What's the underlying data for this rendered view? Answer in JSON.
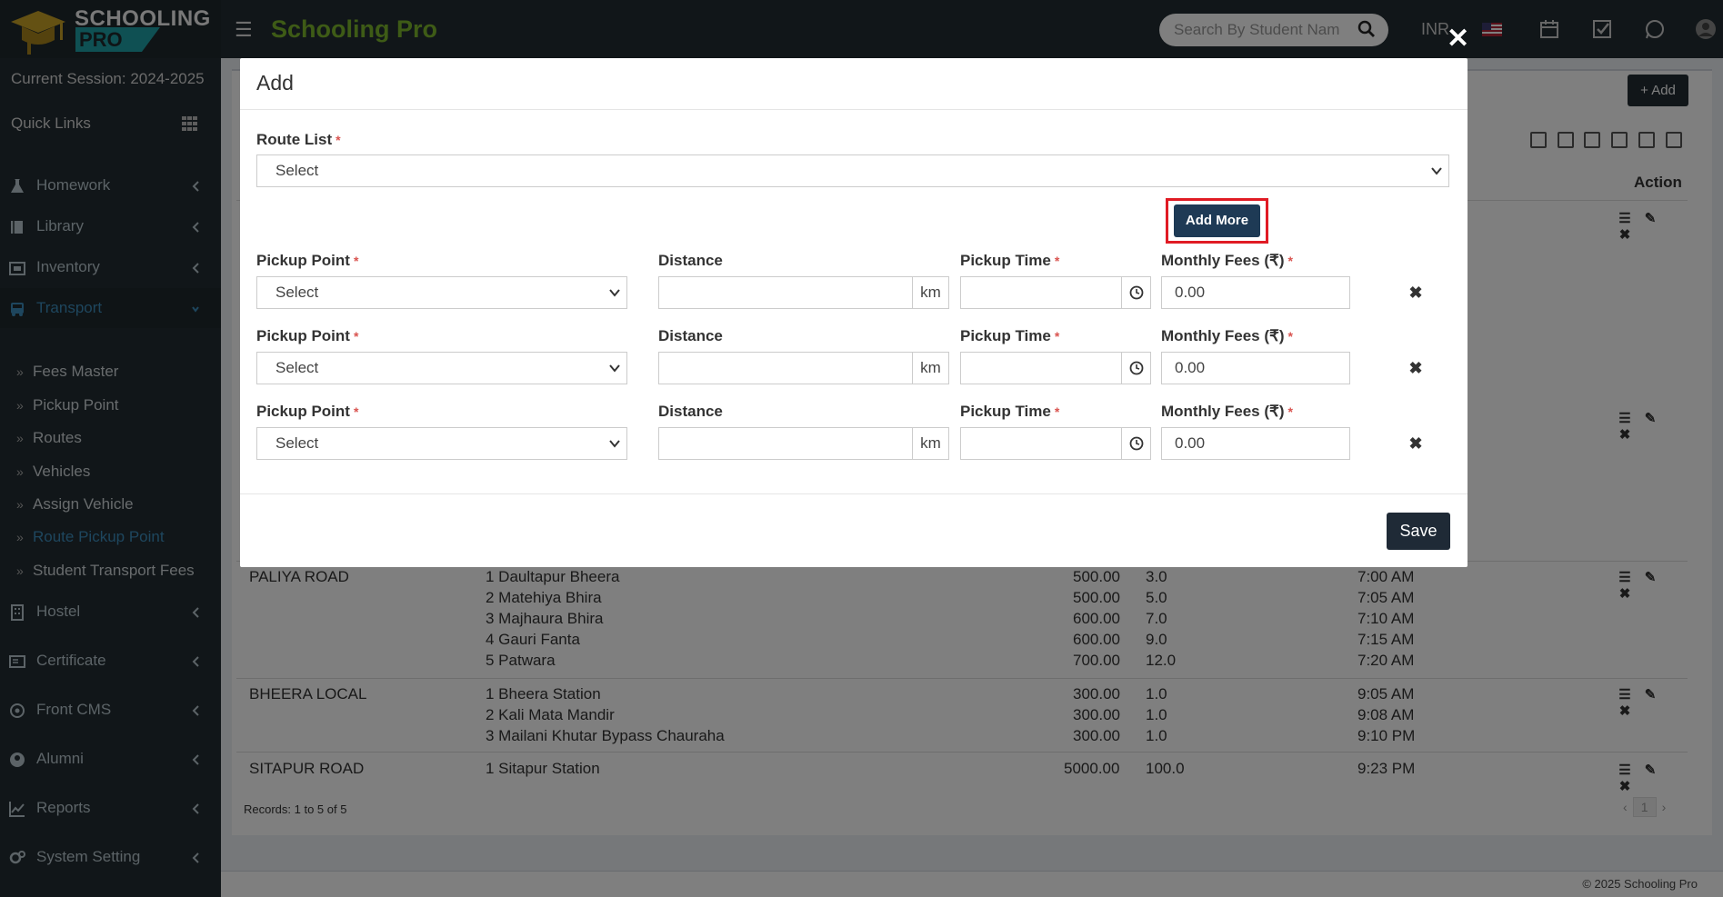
{
  "topbar": {
    "logo_line1": "SCHOOLING",
    "logo_line2": "PRO",
    "app_title": "Schooling Pro",
    "search_placeholder": "Search By Student Nam",
    "currency": "INR"
  },
  "sidebar": {
    "session": "Current Session: 2024-2025",
    "quick_links": "Quick Links",
    "items": [
      {
        "label": "Homework",
        "icon": "flask-icon"
      },
      {
        "label": "Library",
        "icon": "book-icon"
      },
      {
        "label": "Inventory",
        "icon": "inventory-icon"
      },
      {
        "label": "Transport",
        "icon": "bus-icon"
      },
      {
        "label": "Hostel",
        "icon": "building-icon"
      },
      {
        "label": "Certificate",
        "icon": "certificate-icon"
      },
      {
        "label": "Front CMS",
        "icon": "cms-icon"
      },
      {
        "label": "Alumni",
        "icon": "alumni-icon"
      },
      {
        "label": "Reports",
        "icon": "chart-line-icon"
      },
      {
        "label": "System Setting",
        "icon": "gears-icon"
      }
    ],
    "transport_sub": [
      "Fees Master",
      "Pickup Point",
      "Routes",
      "Vehicles",
      "Assign Vehicle",
      "Route Pickup Point",
      "Student Transport Fees"
    ]
  },
  "page": {
    "add_button": "Add",
    "action_header": "Action",
    "rows": [
      {
        "route": "PALIYA ROAD",
        "points": [
          "1 Daultapur Bheera",
          "2 Matehiya Bhira",
          "3 Majhaura Bhira",
          "4 Gauri Fanta",
          "5 Patwara"
        ],
        "fees": [
          "500.00",
          "500.00",
          "600.00",
          "600.00",
          "700.00"
        ],
        "dist": [
          "3.0",
          "5.0",
          "7.0",
          "9.0",
          "12.0"
        ],
        "times": [
          "7:00 AM",
          "7:05 AM",
          "7:10 AM",
          "7:15 AM",
          "7:20 AM"
        ]
      },
      {
        "route": "BHEERA LOCAL",
        "points": [
          "1 Bheera Station",
          "2 Kali Mata Mandir",
          "3 Mailani Khutar Bypass Chauraha"
        ],
        "fees": [
          "300.00",
          "300.00",
          "300.00"
        ],
        "dist": [
          "1.0",
          "1.0",
          "1.0"
        ],
        "times": [
          "9:05 AM",
          "9:08 AM",
          "9:10 PM"
        ]
      },
      {
        "route": "SITAPUR ROAD",
        "points": [
          "1 Sitapur Station"
        ],
        "fees": [
          "5000.00"
        ],
        "dist": [
          "100.0"
        ],
        "times": [
          "9:23 PM"
        ]
      }
    ],
    "records": "Records: 1 to 5 of 5",
    "page_num": "1",
    "footer": "© 2025 Schooling Pro"
  },
  "modal": {
    "title": "Add",
    "route_list_label": "Route List",
    "route_list_value": "Select",
    "add_more": "Add More",
    "labels": {
      "pickup": "Pickup Point",
      "distance": "Distance",
      "pickup_time": "Pickup Time",
      "monthly_fees": "Monthly Fees (₹)"
    },
    "rows": [
      {
        "pickup": "Select",
        "distance": "",
        "unit": "km",
        "time": "",
        "fees": "0.00"
      },
      {
        "pickup": "Select",
        "distance": "",
        "unit": "km",
        "time": "",
        "fees": "0.00"
      },
      {
        "pickup": "Select",
        "distance": "",
        "unit": "km",
        "time": "",
        "fees": "0.00"
      }
    ],
    "save": "Save",
    "required_mark": "*"
  }
}
